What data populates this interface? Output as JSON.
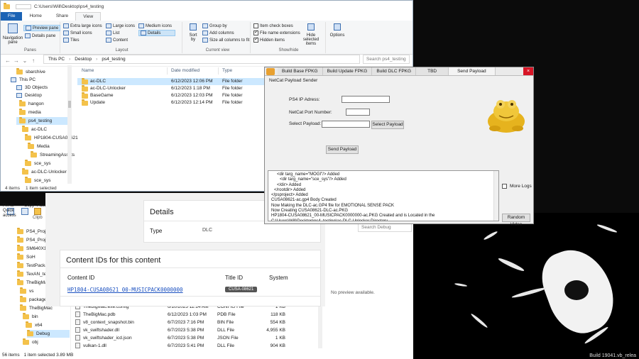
{
  "explorer": {
    "title_path": "C:\\Users\\Will\\Desktop\\ps4_testing",
    "tabs": [
      "File",
      "Home",
      "Share",
      "View"
    ],
    "ribbon": {
      "panes": {
        "nav_pane": "Navigation pane",
        "preview": "Preview pane",
        "details": "Details pane",
        "title": "Panes"
      },
      "layout": {
        "xl_icons": "Extra large icons",
        "large_icons": "Large icons",
        "medium_icons": "Medium icons",
        "small_icons": "Small icons",
        "list": "List",
        "details": "Details",
        "tiles": "Tiles",
        "content": "Content",
        "title": "Layout"
      },
      "current_view": {
        "sort_by": "Sort by",
        "group_by": "Group by",
        "add_columns": "Add columns",
        "size_columns": "Size all columns to fit",
        "title": "Current view"
      },
      "show_hide": {
        "item_checkboxes": "Item check boxes",
        "file_ext": "File name extensions",
        "hidden_items": "Hidden items",
        "hide_selected": "Hide selected items",
        "title": "Show/hide"
      },
      "options": "Options"
    },
    "breadcrumb": [
      "This PC",
      "Desktop",
      "ps4_testing"
    ],
    "search_placeholder": "Search ps4_testing",
    "nav_items": [
      "sbarchive",
      "This PC",
      "3D Objects",
      "Desktop",
      "hangon",
      "media",
      "ps4_testing",
      "ac-DLC",
      "HP1804-CUSA08621",
      "Media",
      "StreamingAssets",
      "sce_sys",
      "ac-DLC-Unlocker",
      "sce_sys"
    ],
    "columns": [
      "Name",
      "Date modified",
      "Type"
    ],
    "files": [
      {
        "name": "ac-DLC",
        "date": "6/12/2023 12:06 PM",
        "type": "File folder"
      },
      {
        "name": "ac-DLC-Unlocker",
        "date": "6/12/2023 1:18 PM",
        "type": "File folder"
      },
      {
        "name": "BaseGame",
        "date": "6/12/2023 12:03 PM",
        "type": "File folder"
      },
      {
        "name": "Update",
        "date": "6/12/2023 12:14 PM",
        "type": "File folder"
      }
    ],
    "status_count": "4 items",
    "status_selected": "1 item selected"
  },
  "explorer2": {
    "clipboard": {
      "pin": "Pin to Quick access",
      "copy": "Copy",
      "paste": "Paste",
      "group": "Clipb"
    },
    "nav_items": [
      "PS4_Projects",
      "PS4_Projects",
      "SM640X12",
      "SoH",
      "TestPackage",
      "TexAN_tex_e",
      "TheBigMac",
      "vs",
      "packages",
      "TheBigMac",
      "bin",
      "x64",
      "Debug",
      "obj"
    ],
    "search_placeholder": "Search Debug",
    "preview_text": "No preview available.",
    "files": [
      {
        "name": "TheBigMac.exe.config",
        "date": "6/10/2023 11:14 AM",
        "type": "CONFIG File",
        "size": "1 KB"
      },
      {
        "name": "TheBigMac.pdb",
        "date": "6/12/2023 1:03 PM",
        "type": "PDB File",
        "size": "118 KB"
      },
      {
        "name": "v8_context_snapshot.bin",
        "date": "6/7/2023 7:16 PM",
        "type": "BIN File",
        "size": "554 KB"
      },
      {
        "name": "vk_swiftshader.dll",
        "date": "6/7/2023 5:38 PM",
        "type": "DLL File",
        "size": "4,955 KB"
      },
      {
        "name": "vk_swiftshader_icd.json",
        "date": "6/7/2023 5:38 PM",
        "type": "JSON File",
        "size": "1 KB"
      },
      {
        "name": "vulkan-1.dll",
        "date": "6/7/2023 5:41 PM",
        "type": "DLL File",
        "size": "904 KB"
      }
    ],
    "status_count": "56 items",
    "status_selected": "1 item selected  3.89 MB"
  },
  "store": {
    "details_heading": "Details",
    "type_label": "Type",
    "type_value": "DLC",
    "content_heading": "Content IDs for this content",
    "col_content_id": "Content ID",
    "col_title_id": "Title ID",
    "col_system": "System",
    "content_id": "HP1804-CUSA08621_00-MUSICPACK0000000",
    "title_id": "CUSA-08621"
  },
  "netcat": {
    "tabs": [
      "Build Base FPKG",
      "Build Update FPKG",
      "Build DLC FPKG",
      "TBD",
      "Send Payload"
    ],
    "close": "×",
    "subtitle": "NetCat Payload Sender",
    "ip_label": "PS4 IP Adress:",
    "port_label": "NetCat Port Number:",
    "payload_label": "Select Payload:",
    "select_btn": "Select Payload",
    "send_btn": "Send Payload",
    "log_lines": [
      "<dir targ_name=\"MOGI\"/> Added",
      "<dir targ_name=\"sce_sys\"/> Added",
      "</dir> Added",
      "</rootdir> Added",
      "</psproject> Added",
      "CUSA08621-ac.gp4 Body Created",
      "Now Making the DLC-ac.GP4 file for EMOTIONAL SENSE PACK",
      "Now Creating CUSA08621-DLC-ac.PKG",
      "HP1804-CUSA08621_00-MUSICPACK0000000-ac.PKG Created and is Located in the C:\\Users\\Will\\Desktop\\ps4_testing\\ac-DLC-Unlocker Directory"
    ],
    "more_logs": "More Logs",
    "random_video": "Random Video"
  },
  "taskbar_hint": "Build 19041.vb_relea"
}
